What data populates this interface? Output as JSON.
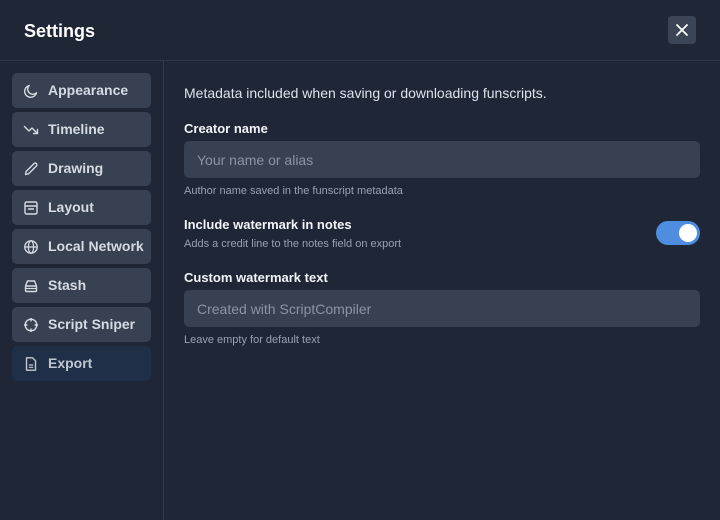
{
  "dialog": {
    "title": "Settings",
    "close_icon": "close-x-icon"
  },
  "sidebar": {
    "items": [
      {
        "label": "Appearance",
        "icon": "moon-icon",
        "active": false
      },
      {
        "label": "Timeline",
        "icon": "trend-down-icon",
        "active": false
      },
      {
        "label": "Drawing",
        "icon": "pencil-icon",
        "active": false
      },
      {
        "label": "Layout",
        "icon": "layout-icon",
        "active": false
      },
      {
        "label": "Local Network",
        "icon": "globe-icon",
        "active": false
      },
      {
        "label": "Stash",
        "icon": "stash-box-icon",
        "active": false
      },
      {
        "label": "Script Sniper",
        "icon": "crosshair-icon",
        "active": false
      },
      {
        "label": "Export",
        "icon": "file-icon",
        "active": true
      }
    ]
  },
  "export": {
    "intro": "Metadata included when saving or downloading funscripts.",
    "creator": {
      "label": "Creator name",
      "value": "",
      "placeholder": "Your name or alias",
      "hint": "Author name saved in the funscript metadata"
    },
    "watermark": {
      "label": "Include watermark in notes",
      "description": "Adds a credit line to the notes field on export",
      "enabled": true
    },
    "custom_watermark": {
      "label": "Custom watermark text",
      "value": "",
      "placeholder": "Created with ScriptCompiler",
      "hint": "Leave empty for default text"
    }
  },
  "colors": {
    "background": "#1f2737",
    "nav_item": "#374152",
    "nav_item_active": "#1f2f47",
    "toggle_on": "#4f8de0"
  }
}
